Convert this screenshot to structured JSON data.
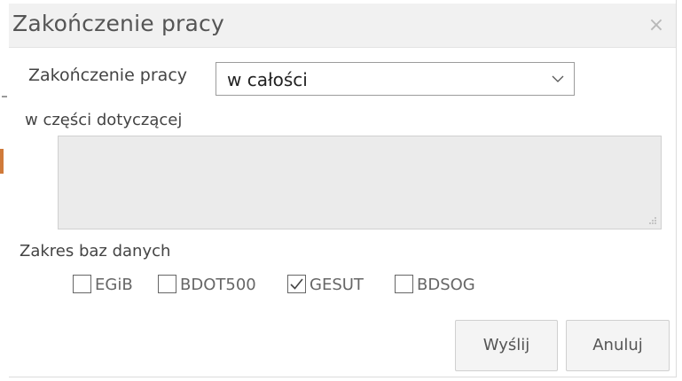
{
  "dialog": {
    "title": "Zakończenie pracy",
    "close_icon": "close-icon"
  },
  "form": {
    "zakonczenie_label": "Zakończenie pracy",
    "zakonczenie_value": "w całości",
    "czesci_label": "w części dotyczącej",
    "czesci_value": "",
    "zakres_label": "Zakres baz danych",
    "databases": [
      {
        "label": "EGiB",
        "checked": false
      },
      {
        "label": "BDOT500",
        "checked": false
      },
      {
        "label": "GESUT",
        "checked": true
      },
      {
        "label": "BDSOG",
        "checked": false
      }
    ]
  },
  "buttons": {
    "send_label": "Wyślij",
    "cancel_label": "Anuluj"
  }
}
